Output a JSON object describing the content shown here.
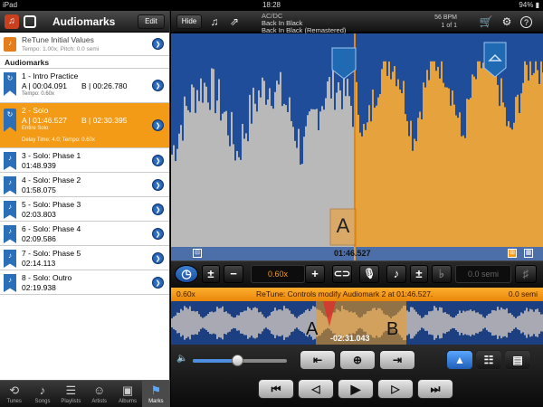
{
  "status_bar": {
    "device": "iPad",
    "time": "18:28",
    "battery": "94%"
  },
  "left": {
    "title": "Audiomarks",
    "edit_label": "Edit",
    "retune": {
      "title": "ReTune Initial Values",
      "subtitle": "Tempo: 1.00x; Pitch: 0.0 semi"
    },
    "section_label": "Audiomarks",
    "marks": [
      {
        "name": "1 - Intro Practice",
        "a": "A | 00:04.091",
        "b": "B | 00:26.780",
        "detail": "Tempo: 0.60x"
      },
      {
        "name": "2 - Solo",
        "a": "A | 01:46.527",
        "b": "B | 02:30.395",
        "detail": "Entire Solo",
        "detail2": "Delay Time: 4.0; Tempo: 0.60x"
      },
      {
        "name": "3 - Solo: Phase 1",
        "time": "01:48.939"
      },
      {
        "name": "4 - Solo: Phase 2",
        "time": "01:58.075"
      },
      {
        "name": "5 - Solo: Phase 3",
        "time": "02:03.803"
      },
      {
        "name": "6 - Solo: Phase 4",
        "time": "02:09.586"
      },
      {
        "name": "7 - Solo: Phase 5",
        "time": "02:14.113"
      },
      {
        "name": "8 - Solo: Outro",
        "time": "02:19.938"
      }
    ]
  },
  "tabs": [
    {
      "label": "Tunes",
      "icon": "tunes-icon"
    },
    {
      "label": "Songs",
      "icon": "music-note-icon"
    },
    {
      "label": "Playlists",
      "icon": "playlists-icon"
    },
    {
      "label": "Artists",
      "icon": "artists-icon"
    },
    {
      "label": "Albums",
      "icon": "albums-icon"
    },
    {
      "label": "Marks",
      "icon": "marks-icon"
    }
  ],
  "topbar": {
    "hide_label": "Hide",
    "artist": "AC/DC",
    "track": "Back In Black",
    "album": "Back In Black (Remastered)",
    "bpm": "56 BPM",
    "count": "1 of 1"
  },
  "waveform": {
    "marker_label": "A",
    "position_label": "01:46.527"
  },
  "controls": {
    "tempo_value": "0.60x",
    "pitch_value": "0.0 semi"
  },
  "info_bar": {
    "left": "0.60x",
    "message": "ReTune: Controls modify Audiomark 2 at 01:46.527.",
    "right": "0.0 semi"
  },
  "overview": {
    "marker_a": "A",
    "marker_b": "B",
    "time_label": "-02:31.043",
    "volume_level": 0.47
  },
  "colors": {
    "accent": "#f39b16",
    "wave_blue": "#1f4d9a",
    "wave_gray": "#b5b5b5"
  }
}
